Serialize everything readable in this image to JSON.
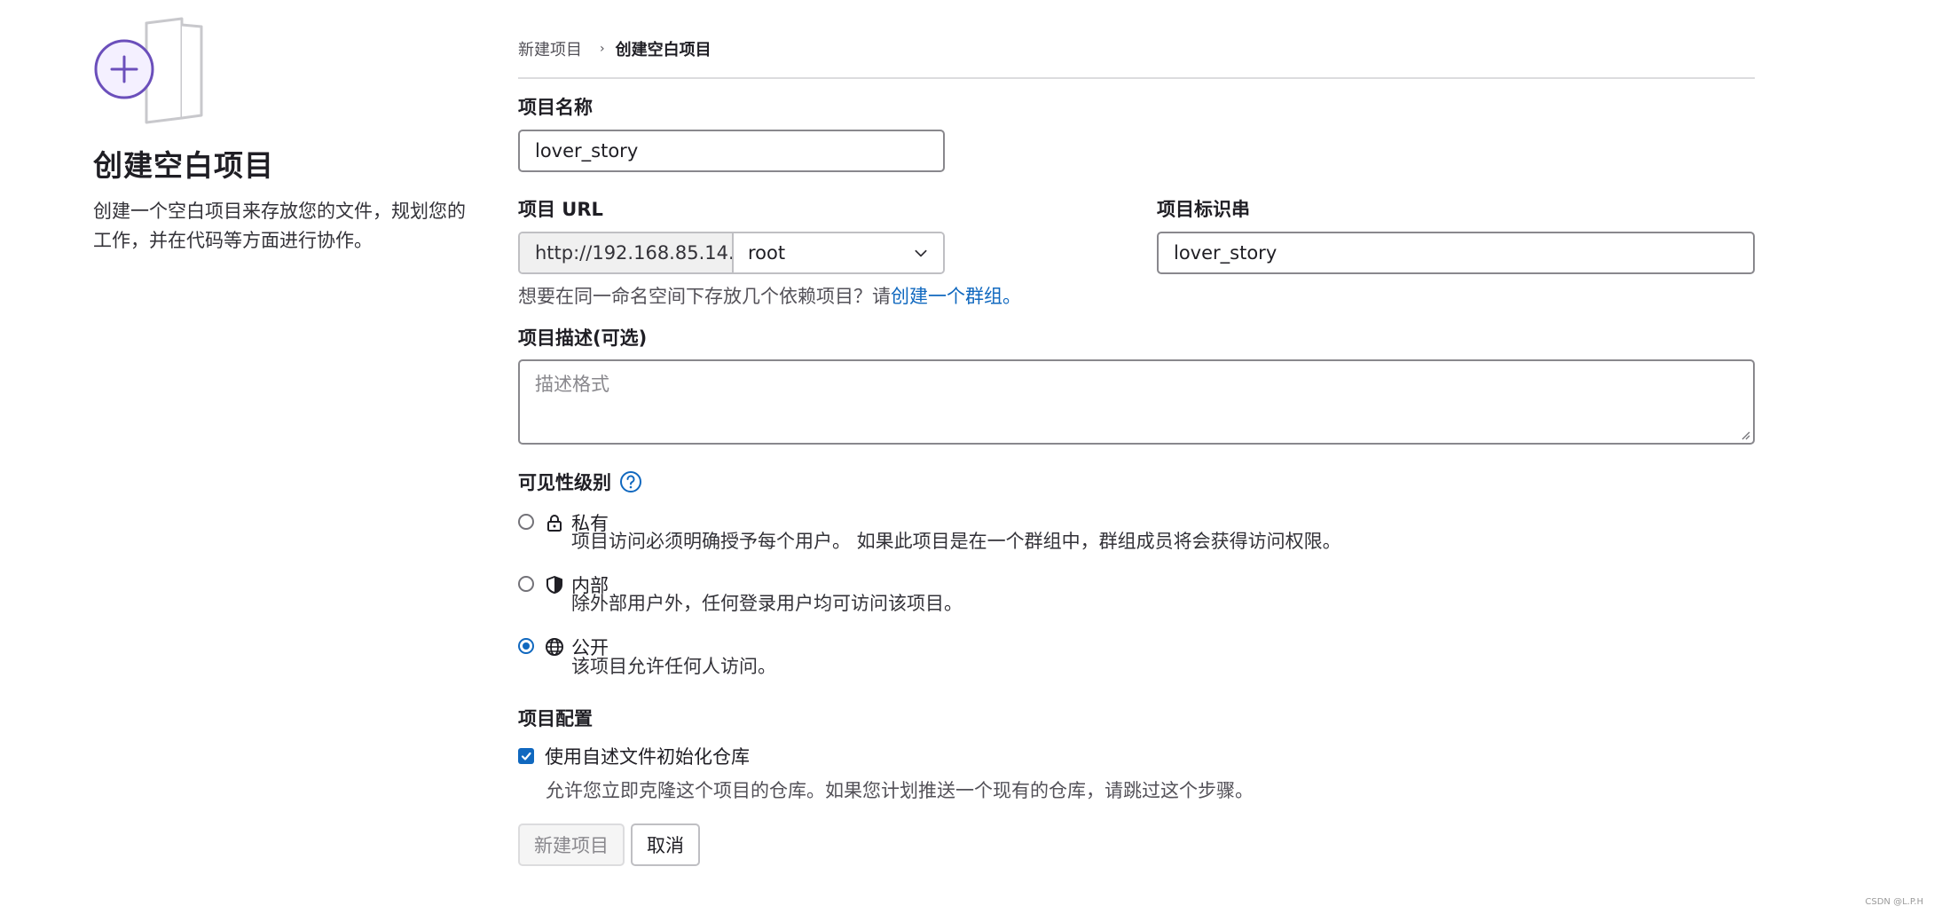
{
  "left": {
    "title": "创建空白项目",
    "description": "创建一个空白项目来存放您的文件，规划您的工作，并在代码等方面进行协作。"
  },
  "breadcrumb": {
    "parent": "新建项目",
    "current": "创建空白项目"
  },
  "form": {
    "project_name_label": "项目名称",
    "project_name_value": "lover_story",
    "project_url_label": "项目 URL",
    "project_url_prefix": "http://192.168.85.14...",
    "namespace_value": "root",
    "project_slug_label": "项目标识串",
    "project_slug_value": "lover_story",
    "group_help_text": "想要在同一命名空间下存放几个依赖项目？请",
    "group_help_link": "创建一个群组。",
    "description_label": "项目描述(可选)",
    "description_placeholder": "描述格式",
    "visibility_label": "可见性级别",
    "visibility_options": [
      {
        "title": "私有",
        "desc": "项目访问必须明确授予每个用户。 如果此项目是在一个群组中，群组成员将会获得访问权限。",
        "icon": "lock-icon",
        "checked": false
      },
      {
        "title": "内部",
        "desc": "除外部用户外，任何登录用户均可访问该项目。",
        "icon": "shield-icon",
        "checked": false
      },
      {
        "title": "公开",
        "desc": "该项目允许任何人访问。",
        "icon": "earth-icon",
        "checked": true
      }
    ],
    "config_label": "项目配置",
    "readme_checkbox_label": "使用自述文件初始化仓库",
    "readme_checked": true,
    "readme_help": "允许您立即克隆这个项目的仓库。如果您计划推送一个现有的仓库，请跳过这个步骤。",
    "create_button": "新建项目",
    "cancel_button": "取消"
  },
  "watermark": "CSDN @L.P.H",
  "colors": {
    "accent": "#6b4fbb",
    "link": "#1068bf",
    "text": "#1f1e24",
    "border": "#89888d"
  }
}
